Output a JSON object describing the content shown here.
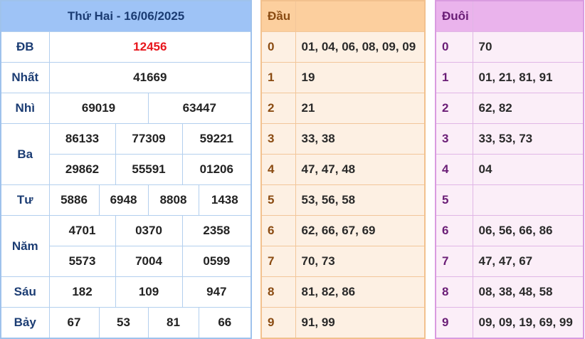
{
  "results": {
    "title": "Thứ Hai - 16/06/2025",
    "db": {
      "label": "ĐB",
      "values": [
        "12456"
      ]
    },
    "nhat": {
      "label": "Nhất",
      "values": [
        "41669"
      ]
    },
    "nhi": {
      "label": "Nhì",
      "values": [
        "69019",
        "63447"
      ]
    },
    "ba": {
      "label": "Ba",
      "values": [
        "86133",
        "77309",
        "59221",
        "29862",
        "55591",
        "01206"
      ]
    },
    "tu": {
      "label": "Tư",
      "values": [
        "5886",
        "6948",
        "8808",
        "1438"
      ]
    },
    "nam": {
      "label": "Năm",
      "values": [
        "4701",
        "0370",
        "2358",
        "5573",
        "7004",
        "0599"
      ]
    },
    "sau": {
      "label": "Sáu",
      "values": [
        "182",
        "109",
        "947"
      ]
    },
    "bay": {
      "label": "Bảy",
      "values": [
        "67",
        "53",
        "81",
        "66"
      ]
    }
  },
  "dau": {
    "header": "Đầu",
    "rows": [
      {
        "digit": "0",
        "values": "01, 04, 06, 08, 09, 09"
      },
      {
        "digit": "1",
        "values": "19"
      },
      {
        "digit": "2",
        "values": "21"
      },
      {
        "digit": "3",
        "values": "33, 38"
      },
      {
        "digit": "4",
        "values": "47, 47, 48"
      },
      {
        "digit": "5",
        "values": "53, 56, 58"
      },
      {
        "digit": "6",
        "values": "62, 66, 67, 69"
      },
      {
        "digit": "7",
        "values": "70, 73"
      },
      {
        "digit": "8",
        "values": "81, 82, 86"
      },
      {
        "digit": "9",
        "values": "91, 99"
      }
    ]
  },
  "duoi": {
    "header": "Đuôi",
    "rows": [
      {
        "digit": "0",
        "values": "70"
      },
      {
        "digit": "1",
        "values": "01, 21, 81, 91"
      },
      {
        "digit": "2",
        "values": "62, 82"
      },
      {
        "digit": "3",
        "values": "33, 53, 73"
      },
      {
        "digit": "4",
        "values": "04"
      },
      {
        "digit": "5",
        "values": ""
      },
      {
        "digit": "6",
        "values": "06, 56, 66, 86"
      },
      {
        "digit": "7",
        "values": "47, 47, 67"
      },
      {
        "digit": "8",
        "values": "08, 38, 48, 58"
      },
      {
        "digit": "9",
        "values": "09, 09, 19, 69, 99"
      }
    ]
  },
  "colors": {
    "special": "#e8161c",
    "title_bg": "#9ec3f6",
    "dau_bg": "#fccf9e",
    "duoi_bg": "#eab3ec"
  }
}
